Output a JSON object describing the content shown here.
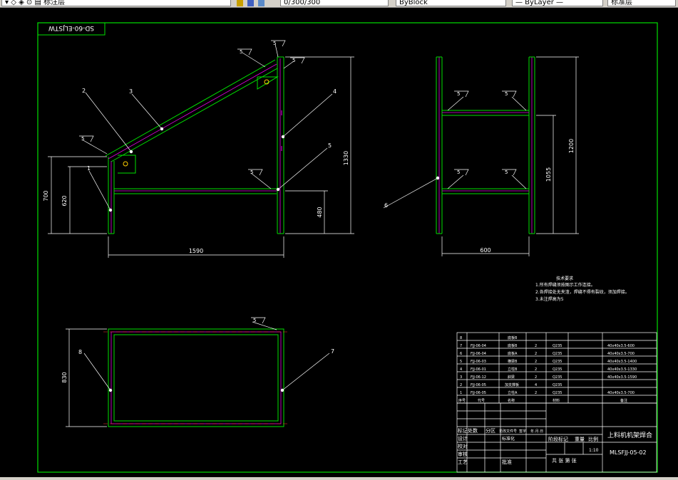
{
  "toolbar": {
    "items": [
      {
        "label": "▾ ◇ ◈ ⊙ ▤ 标注层"
      },
      {
        "label": "0/300/300"
      },
      {
        "label": "ByBlock"
      },
      {
        "label": "— ByLayer —"
      },
      {
        "label": "标准层"
      }
    ]
  },
  "drawing": {
    "code_box": "SD-60-ELJSTW",
    "balloons": {
      "b1": "1",
      "b2": "2",
      "b3": "3",
      "b4": "4",
      "b5": "5",
      "b6": "6",
      "b7": "7",
      "b8": "8"
    },
    "weld_symbol": "5",
    "dims": {
      "d1590": "1590",
      "d700": "700",
      "d620": "620",
      "d1330": "1330",
      "d480": "480",
      "d600": "600",
      "d1055": "1055",
      "d1200": "1200",
      "d830": "830"
    },
    "notes": {
      "title": "技术要求",
      "line1": "1.所有焊缝须按图示工作连接。",
      "line2": "2.各焊接处无夹渣，焊缝不得有裂纹，须加焊接。",
      "line3": "3.未注焊高为5"
    },
    "bom": {
      "rows": [
        {
          "no": "8",
          "code": "",
          "name": "底板B",
          "qty": "",
          "mat": "",
          "spec": ""
        },
        {
          "no": "7",
          "code": "FJJ-06-04",
          "name": "底板B",
          "qty": "2",
          "mat": "Q235",
          "spec": "40x40x3.5-600"
        },
        {
          "no": "6",
          "code": "FJJ-06-04",
          "name": "底板A",
          "qty": "2",
          "mat": "Q235",
          "spec": "40x40x3.5-700"
        },
        {
          "no": "5",
          "code": "FJJ-06-03",
          "name": "横梁B",
          "qty": "2",
          "mat": "Q235",
          "spec": "40x40x3.5-1400"
        },
        {
          "no": "4",
          "code": "FJJ-06-01",
          "name": "立柱B",
          "qty": "2",
          "mat": "Q235",
          "spec": "40x40x3.5-1330"
        },
        {
          "no": "3",
          "code": "FJJ-06-12",
          "name": "斜梁",
          "qty": "2",
          "mat": "Q235",
          "spec": "40x40x3.5-1590"
        },
        {
          "no": "2",
          "code": "FJJ-06-05",
          "name": "加支撑板",
          "qty": "4",
          "mat": "Q235",
          "spec": ""
        },
        {
          "no": "1",
          "code": "FJJ-06-05",
          "name": "立柱A",
          "qty": "2",
          "mat": "Q235",
          "spec": "40x40x3.5-700"
        }
      ],
      "header": {
        "no": "序号",
        "code": "代号",
        "name": "名称",
        "mat": "材料",
        "spec": "备注"
      }
    },
    "title_block": {
      "title": "上料机机架焊合",
      "drawing_no": "MLSFJJ-05-02",
      "mark": "标记处数",
      "zone": "分区",
      "change_doc": "更改文件号",
      "signature": "签字",
      "date": "年.月.日",
      "design": "设计",
      "standard": "标准化",
      "proofread": "校对",
      "review": "审核",
      "process": "工艺",
      "approve": "批准",
      "stage": "阶段标记",
      "weight": "重量",
      "ratio": "比例",
      "ratio_val": "1:10",
      "sheets": "共  张  第  张"
    }
  }
}
